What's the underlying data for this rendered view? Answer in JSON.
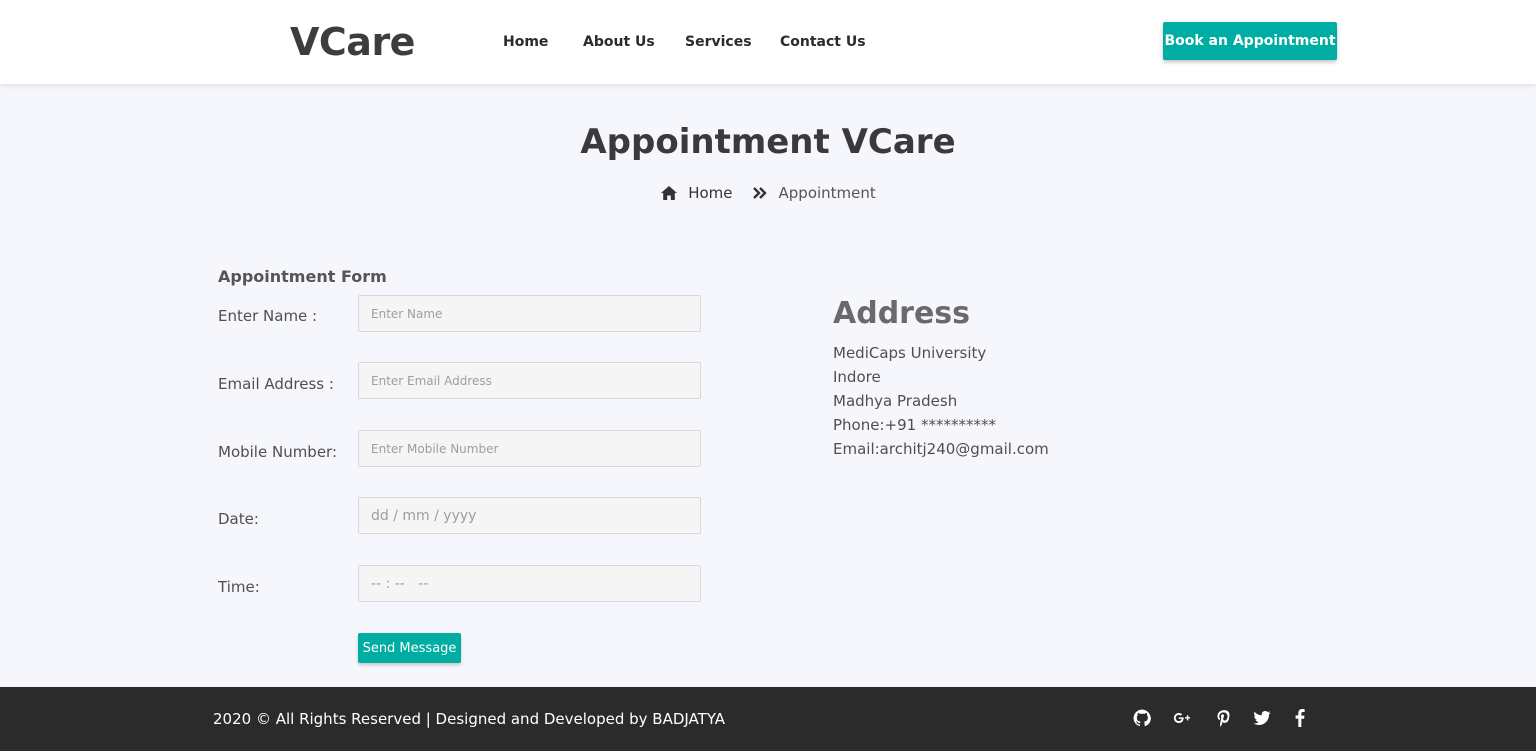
{
  "header": {
    "logo": "VCare",
    "nav": [
      {
        "label": "Home"
      },
      {
        "label": "About Us"
      },
      {
        "label": "Services"
      },
      {
        "label": "Contact Us"
      }
    ],
    "cta_label": "Book an Appointment"
  },
  "hero": {
    "title": "Appointment VCare",
    "breadcrumb": {
      "home": "Home",
      "current": "Appointment",
      "home_icon": "home-icon",
      "separator_icon": "double-chevron-right-icon"
    }
  },
  "form": {
    "title": "Appointment Form",
    "fields": {
      "name": {
        "label": "Enter Name :",
        "placeholder": "Enter Name",
        "value": ""
      },
      "email": {
        "label": "Email Address :",
        "placeholder": "Enter Email Address",
        "value": ""
      },
      "mobile": {
        "label": "Mobile Number:",
        "placeholder": "Enter Mobile Number",
        "value": ""
      },
      "date": {
        "label": "Date:",
        "placeholder": "dd / mm / yyyy"
      },
      "time": {
        "label": "Time:",
        "placeholder": "-- : --   --"
      }
    },
    "submit_label": "Send Message"
  },
  "address": {
    "title": "Address",
    "lines": [
      "MediCaps University",
      "Indore",
      "Madhya Pradesh",
      "Phone:+91 **********",
      "Email:architj240@gmail.com"
    ]
  },
  "footer": {
    "copyright": "2020 © All Rights Reserved | Designed and Developed by BADJATYA",
    "social_icons": [
      "github-icon",
      "google-plus-icon",
      "pinterest-icon",
      "twitter-icon",
      "facebook-icon"
    ]
  },
  "colors": {
    "accent": "#00ada2",
    "background": "#f6f7fd",
    "footer": "#2b2b2b",
    "text": "#4a4a4a"
  }
}
